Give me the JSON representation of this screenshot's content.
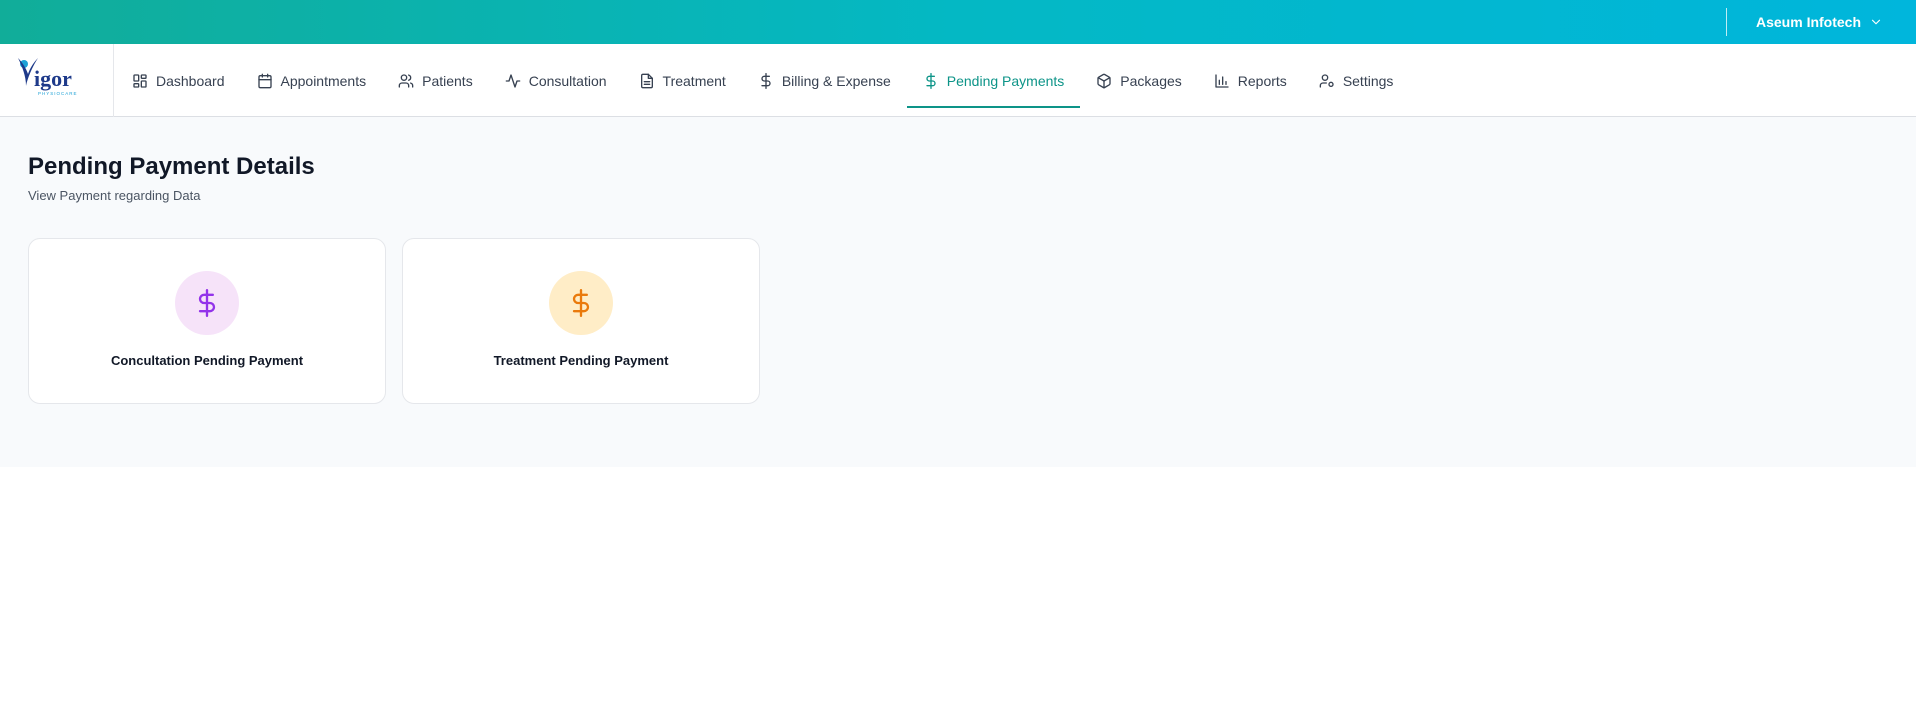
{
  "header": {
    "account_name": "Aseum Infotech"
  },
  "logo": {
    "name": "igor",
    "tagline": "PHYSIOCARE"
  },
  "nav": {
    "items": [
      {
        "label": "Dashboard",
        "icon": "dashboard-icon"
      },
      {
        "label": "Appointments",
        "icon": "calendar-icon"
      },
      {
        "label": "Patients",
        "icon": "users-icon"
      },
      {
        "label": "Consultation",
        "icon": "activity-icon"
      },
      {
        "label": "Treatment",
        "icon": "document-icon"
      },
      {
        "label": "Billing & Expense",
        "icon": "dollar-icon"
      },
      {
        "label": "Pending Payments",
        "icon": "dollar-icon",
        "active": true
      },
      {
        "label": "Packages",
        "icon": "package-icon"
      },
      {
        "label": "Reports",
        "icon": "bar-chart-icon"
      },
      {
        "label": "Settings",
        "icon": "user-cog-icon"
      }
    ]
  },
  "page": {
    "title": "Pending Payment Details",
    "subtitle": "View Payment regarding Data"
  },
  "cards": [
    {
      "label": "Concultation Pending Payment",
      "icon": "dollar-icon",
      "icon_color": "#9333ea",
      "circle_color": "#f6e3f9"
    },
    {
      "label": "Treatment Pending Payment",
      "icon": "dollar-icon",
      "icon_color": "#ea7a0c",
      "circle_color": "#ffedc7"
    }
  ],
  "colors": {
    "accent": "#0d9488",
    "header_gradient_start": "#11ad99",
    "header_gradient_end": "#00b6dc"
  }
}
